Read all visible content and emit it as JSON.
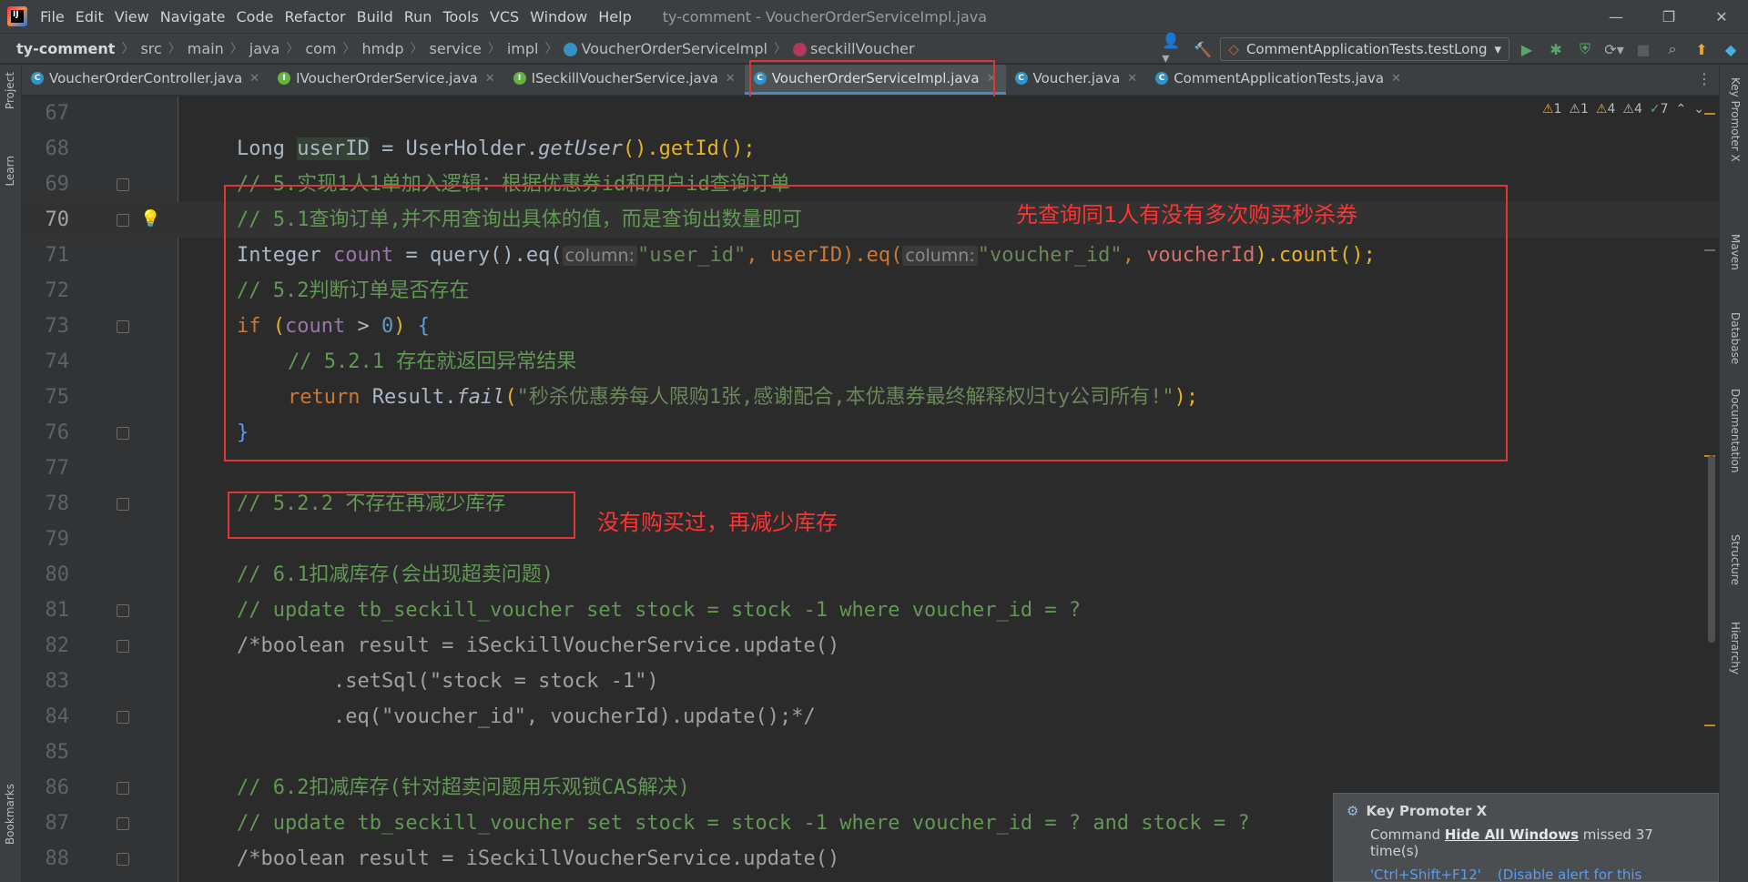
{
  "menubar": {
    "logo_text": "IJ",
    "items": [
      "File",
      "Edit",
      "View",
      "Navigate",
      "Code",
      "Refactor",
      "Build",
      "Run",
      "Tools",
      "VCS",
      "Window",
      "Help"
    ],
    "title": "ty-comment - VoucherOrderServiceImpl.java"
  },
  "window_controls": {
    "minimize": "—",
    "restore": "❐",
    "close": "✕"
  },
  "breadcrumb": {
    "project": "ty-comment",
    "path": [
      "src",
      "main",
      "java",
      "com",
      "hmdp",
      "service",
      "impl"
    ],
    "class": "VoucherOrderServiceImpl",
    "method": "seckillVoucher"
  },
  "toolbar": {
    "run_config": "CommentApplicationTests.testLong"
  },
  "tabs": [
    {
      "label": "VoucherOrderController.java",
      "icon": "C",
      "color": "#3592c4",
      "active": false
    },
    {
      "label": "IVoucherOrderService.java",
      "icon": "I",
      "color": "#62b543",
      "active": false
    },
    {
      "label": "ISeckillVoucherService.java",
      "icon": "I",
      "color": "#62b543",
      "active": false
    },
    {
      "label": "VoucherOrderServiceImpl.java",
      "icon": "C",
      "color": "#3592c4",
      "active": true
    },
    {
      "label": "Voucher.java",
      "icon": "C",
      "color": "#3592c4",
      "active": false
    },
    {
      "label": "CommentApplicationTests.java",
      "icon": "C",
      "color": "#3592c4",
      "active": false
    }
  ],
  "left_tools": [
    "Project",
    "Learn",
    "Bookmarks"
  ],
  "right_tools": [
    "Key Promoter X",
    "Maven",
    "Database",
    "Documentation",
    "Structure",
    "Hierarchy"
  ],
  "inspections": {
    "errors_a": "1",
    "errors_b": "1",
    "warnings_a": "4",
    "warnings_b": "4",
    "ok": "7"
  },
  "code": {
    "line_numbers": [
      "67",
      "68",
      "69",
      "70",
      "71",
      "72",
      "73",
      "74",
      "75",
      "76",
      "77",
      "78",
      "79",
      "80",
      "81",
      "82",
      "83",
      "84",
      "85",
      "86",
      "87",
      "88"
    ],
    "current_line": "70",
    "l68": {
      "type": "Long ",
      "var": "userID",
      "rest_a": " = UserHolder.",
      "getUser": "getUser",
      "rest_b": "().getId();"
    },
    "l69": "// 5.实现1人1单加入逻辑：根据优惠券id和用户id查询订单",
    "l70": "// 5.1查询订单,并不用查询出具体的值，而是查询出数量即可",
    "l71": {
      "a": "Integer ",
      "count": "count",
      "b": " = query().eq(",
      "hint1": "column:",
      "s1": "\"user_id\"",
      "c": ", userID).eq(",
      "hint2": "column:",
      "s2": "\"voucher_id\"",
      "d": ", ",
      "vid": "voucherId",
      "e": ").count();"
    },
    "l72": "// 5.2判断订单是否存在",
    "l73": {
      "kw": "if ",
      "p1": "(",
      "count": "count",
      "b": " > ",
      "num": "0",
      "p2": ")",
      "brace": " {"
    },
    "l74": "// 5.2.1 存在就返回异常结果",
    "l75": {
      "kw": "return ",
      "a": "Result.",
      "fn": "fail",
      "p1": "(",
      "str": "\"秒杀优惠券每人限购1张,感谢配合,本优惠券最终解释权归ty公司所有!\"",
      "p2": ");"
    },
    "l76": "}",
    "l78": "// 5.2.2 不存在再减少库存",
    "l80": "// 6.1扣减库存(会出现超卖问题)",
    "l81": "// update tb_seckill_voucher set stock = stock -1 where voucher_id = ?",
    "l82": "/*boolean result = iSeckillVoucherService.update()",
    "l83": "        .setSql(\"stock = stock -1\")",
    "l84": "        .eq(\"voucher_id\", voucherId).update();*/",
    "l86": "// 6.2扣减库存(针对超卖问题用乐观锁CAS解决)",
    "l87": "// update tb_seckill_voucher set stock = stock -1 where voucher_id = ? and stock = ?",
    "l88": "/*boolean result = iSeckillVoucherService.update()"
  },
  "annotations": {
    "box1_text": "先查询同1人有没有多次购买秒杀券",
    "box2_text": "没有购买过，再减少库存"
  },
  "notification": {
    "title": "Key Promoter X",
    "body_a": "Command ",
    "body_cmd": "Hide All Windows",
    "body_b": " missed 37 time(s)",
    "shortcut": "'Ctrl+Shift+F12'",
    "disable": "(Disable alert for this shortcut)"
  },
  "colors": {
    "annotation_red": "#e03535",
    "accent_blue": "#4a88c7",
    "comment_green": "#629755"
  }
}
